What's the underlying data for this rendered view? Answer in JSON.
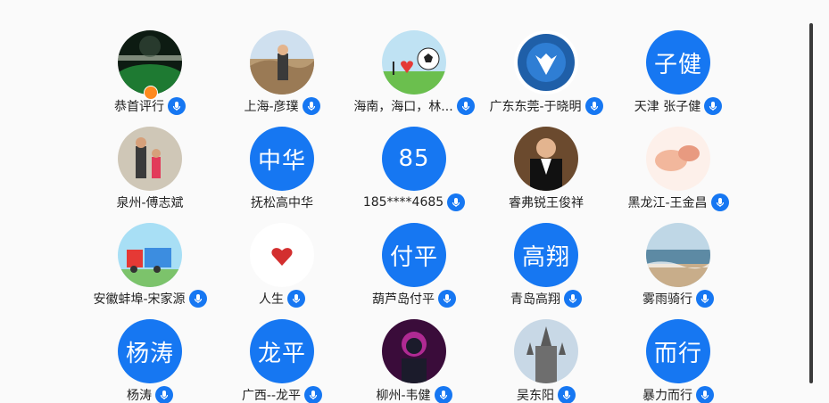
{
  "colors": {
    "accent": "#1677f2",
    "badge": "#ff8a1e"
  },
  "users": [
    {
      "label": "恭首评行",
      "avatar_type": "photo",
      "avatar_icon": "stadium-photo",
      "has_badge": true
    },
    {
      "label": "上海-彦璞",
      "avatar_type": "photo",
      "avatar_icon": "person-coast-photo"
    },
    {
      "label": "海南，海口，林...",
      "avatar_type": "photo",
      "avatar_icon": "i-love-football-photo"
    },
    {
      "label": "广东东莞-于晓明",
      "avatar_type": "photo",
      "avatar_icon": "football-club-logo"
    },
    {
      "label": "天津 张子健",
      "avatar_type": "text",
      "avatar_text": "子健"
    },
    {
      "label": "泉州-傅志斌",
      "avatar_type": "photo",
      "avatar_icon": "family-photo",
      "no_mic": true
    },
    {
      "label": "抚松高中华",
      "avatar_type": "text",
      "avatar_text": "中华",
      "no_mic": true
    },
    {
      "label": "185****4685",
      "avatar_type": "text",
      "avatar_text": "85"
    },
    {
      "label": "睿弗锐王俊祥",
      "avatar_type": "photo",
      "avatar_icon": "man-suit-photo",
      "no_mic": true
    },
    {
      "label": "黑龙江-王金昌",
      "avatar_type": "photo",
      "avatar_icon": "baby-hands-photo"
    },
    {
      "label": "安徽蚌埠-宋家源",
      "avatar_type": "photo",
      "avatar_icon": "train-cartoon"
    },
    {
      "label": "人生",
      "avatar_type": "photo",
      "avatar_icon": "heart-photo"
    },
    {
      "label": "葫芦岛付平",
      "avatar_type": "text",
      "avatar_text": "付平"
    },
    {
      "label": "青岛高翔",
      "avatar_type": "text",
      "avatar_text": "高翔"
    },
    {
      "label": "雾雨骑行",
      "avatar_type": "photo",
      "avatar_icon": "beach-photo"
    },
    {
      "label": "杨涛",
      "avatar_type": "text",
      "avatar_text": "杨涛"
    },
    {
      "label": "广西--龙平",
      "avatar_type": "text",
      "avatar_text": "龙平"
    },
    {
      "label": "柳州-韦健",
      "avatar_type": "photo",
      "avatar_icon": "neon-person-photo"
    },
    {
      "label": "吴东阳",
      "avatar_type": "photo",
      "avatar_icon": "cathedral-photo"
    },
    {
      "label": "暴力而行",
      "avatar_type": "text",
      "avatar_text": "而行"
    }
  ]
}
